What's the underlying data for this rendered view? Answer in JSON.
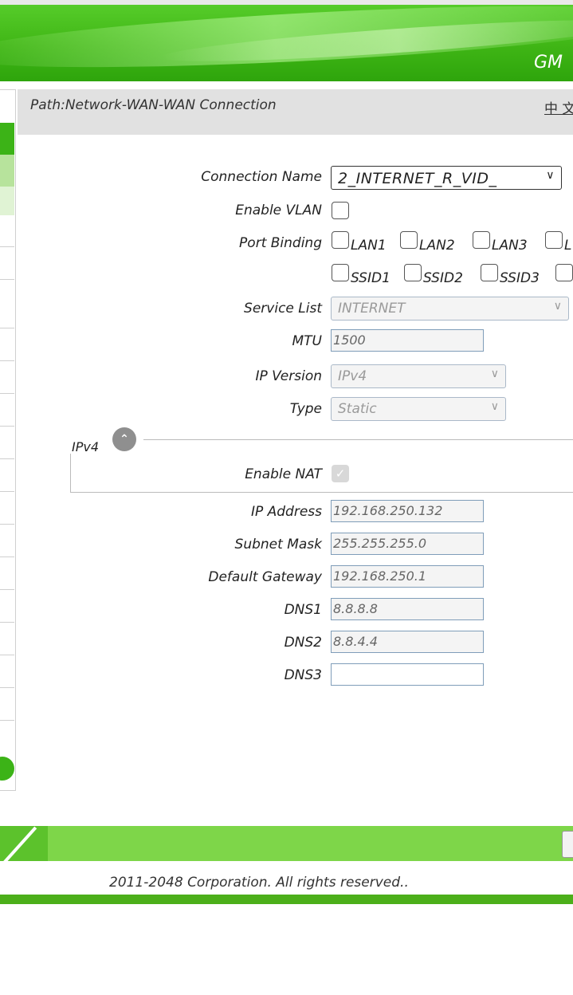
{
  "header": {
    "brand": "GM"
  },
  "path": {
    "text": "Path:Network-WAN-WAN Connection",
    "lang_link": "中 文"
  },
  "form": {
    "connection_name": {
      "label": "Connection Name",
      "value": "2_INTERNET_R_VID_"
    },
    "enable_vlan": {
      "label": "Enable VLAN",
      "checked": false
    },
    "port_binding": {
      "label": "Port Binding",
      "lan": [
        "LAN1",
        "LAN2",
        "LAN3",
        "L"
      ],
      "ssid": [
        "SSID1",
        "SSID2",
        "SSID3"
      ]
    },
    "service_list": {
      "label": "Service List",
      "value": "INTERNET"
    },
    "mtu": {
      "label": "MTU",
      "value": "1500"
    },
    "ip_version": {
      "label": "IP Version",
      "value": "IPv4"
    },
    "type": {
      "label": "Type",
      "value": "Static"
    },
    "ipv4_section": {
      "legend": "IPv4"
    },
    "enable_nat": {
      "label": "Enable NAT",
      "checked": true
    },
    "ip_address": {
      "label": "IP Address",
      "value": "192.168.250.132"
    },
    "subnet_mask": {
      "label": "Subnet Mask",
      "value": "255.255.255.0"
    },
    "default_gateway": {
      "label": "Default Gateway",
      "value": "192.168.250.1"
    },
    "dns1": {
      "label": "DNS1",
      "value": "8.8.8.8"
    },
    "dns2": {
      "label": "DNS2",
      "value": "8.8.4.4"
    },
    "dns3": {
      "label": "DNS3",
      "value": ""
    }
  },
  "footer": {
    "copyright": "2011-2048 Corporation. All rights reserved.."
  },
  "colors": {
    "accent": "#3fb515",
    "footer_bar": "#7ed649"
  }
}
